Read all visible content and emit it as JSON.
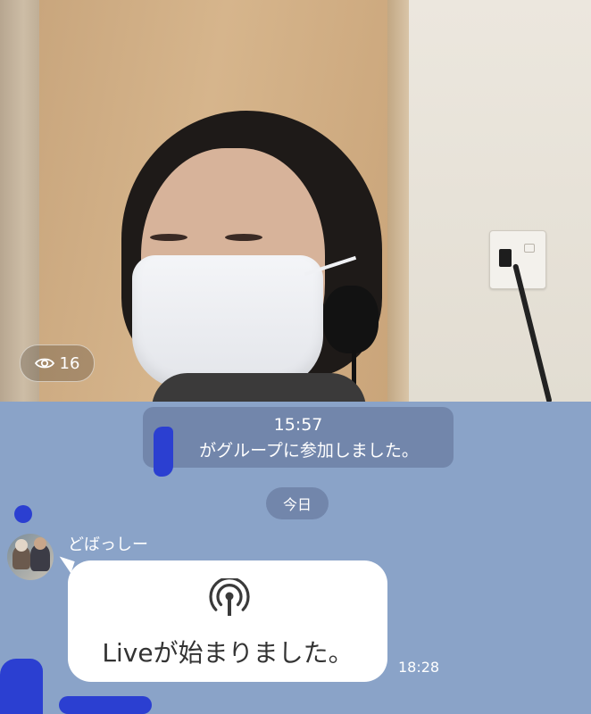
{
  "live": {
    "viewer_count": "16",
    "viewer_icon": "eye-icon"
  },
  "chat": {
    "system_message": {
      "time": "15:57",
      "text": "がグループに参加しました。"
    },
    "date_separator": "今日",
    "messages": [
      {
        "sender": "どばっしー",
        "text": "Liveが始まりました。",
        "icon": "live-broadcast-icon",
        "time": "18:28"
      }
    ]
  },
  "colors": {
    "chat_background": "#8aa3c8",
    "bubble": "#ffffff",
    "system_chip": "#5e7094"
  }
}
